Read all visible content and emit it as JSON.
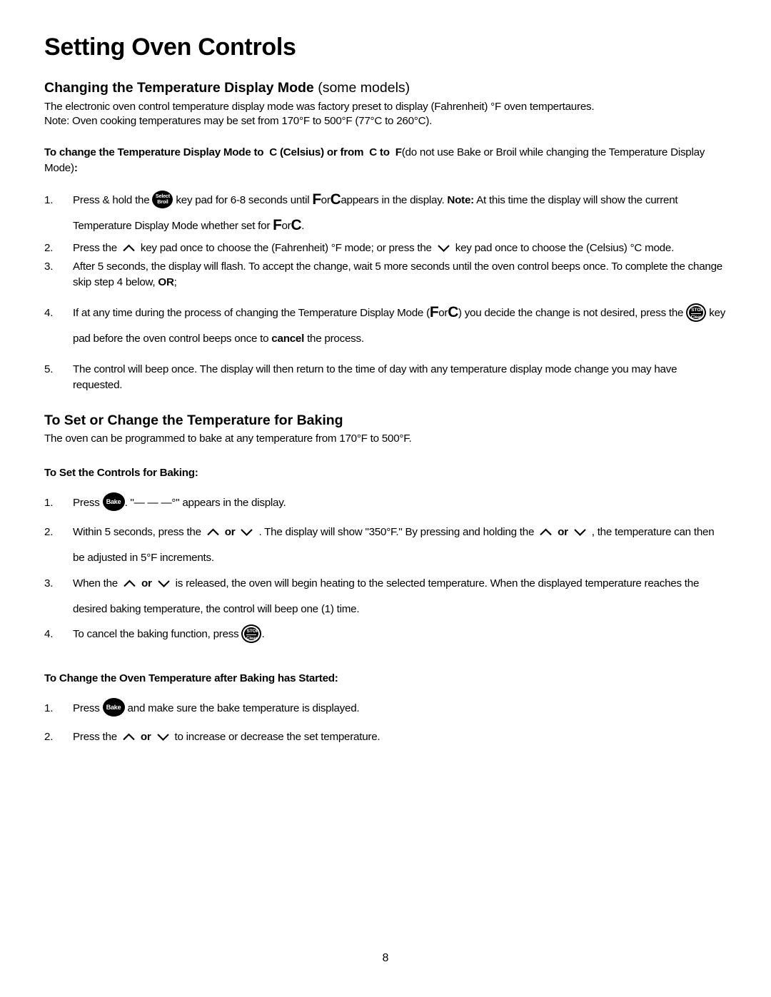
{
  "page": {
    "title": "Setting Oven Controls",
    "number": "8"
  },
  "section_display_mode": {
    "heading_bold": "Changing the Temperature Display Mode",
    "heading_light": "(some models)",
    "paragraph_line1": "The electronic oven control temperature display mode was factory preset to display (Fahrenheit) °F oven tempertaures.",
    "paragraph_line2": "Note: Oven cooking temperatures may be set from 170°F to 500°F (77°C to 260°C).",
    "lead_bold_a": "To change the Temperature Display Mode to",
    "lead_c1": "C",
    "lead_bold_b": "(Celsius) or from",
    "lead_c2": "C",
    "lead_bold_c": "to",
    "lead_f1": "F",
    "lead_light": "(do not use Bake or Broil while changing the Temperature Display Mode)",
    "lead_colon": ":",
    "steps": [
      {
        "num": "1.",
        "t1": "Press & hold the",
        "icon": "select-broil-keypad",
        "t2": "key pad for 6-8 seconds until",
        "glyph_f": "F",
        "t3": "or",
        "glyph_c": "C",
        "t4": "appears in the display.",
        "note_label": "Note:",
        "t5": "At this time the display will show the current Temperature Display Mode whether set for",
        "glyph_f2": "F",
        "t6": "or",
        "glyph_c2": "C",
        "t7": "."
      },
      {
        "num": "2.",
        "t1": "Press the",
        "icon_up": "chevron-up-icon",
        "t2": "key pad once to choose the (Fahrenheit) °F mode; or press  the",
        "icon_down": "chevron-down-icon",
        "t3": "key pad once to choose the (Celsius) °C mode."
      },
      {
        "num": "3.",
        "t1": "After 5 seconds, the display will flash. To accept the change, wait 5 more seconds until the oven control beeps once. To complete the change skip step 4 below,",
        "bold_or": "OR",
        "t2": ";"
      },
      {
        "num": "4.",
        "t1": "If at any time during the process of changing the Temperature Display Mode (",
        "glyph_f": "F",
        "t2": "or",
        "glyph_c": "C",
        "t3": ") you decide the change is not desired, press the",
        "icon": "stop-clear-keypad",
        "t4": "key pad before the oven control beeps once to",
        "bold_cancel": "cancel",
        "t5": "the process."
      },
      {
        "num": "5.",
        "t1": "The control will beep once. The display will then return to the time of day with any temperature display mode change you may have requested."
      }
    ]
  },
  "section_baking": {
    "heading": "To Set or Change the Temperature for Baking",
    "paragraph": "The oven can be programmed to bake at any temperature from 170°F to 500°F.",
    "sub_heading_1": "To Set the Controls for Baking:",
    "steps_1": [
      {
        "num": "1.",
        "t1": "Press",
        "icon": "bake-keypad",
        "t2": ". \"— — —°\" appears in the display."
      },
      {
        "num": "2.",
        "t1": "Within 5 seconds, press the",
        "icon_up": "chevron-up-icon",
        "bold_or": "or",
        "icon_down": "chevron-down-icon",
        "t2": ". The display will show \"350°F.\" By pressing and holding the",
        "icon_up2": "chevron-up-icon",
        "bold_or2": "or",
        "icon_down2": "chevron-down-icon",
        "t3": ", the temperature can then be adjusted in 5°F increments."
      },
      {
        "num": "3.",
        "t1": "When the",
        "icon_up": "chevron-up-icon",
        "bold_or": "or",
        "icon_down": "chevron-down-icon",
        "t2": "is released, the oven will begin heating to the selected temperature. When the displayed temperature reaches the desired baking temperature, the control will beep one (1) time."
      },
      {
        "num": "4.",
        "t1": "To cancel the baking function, press",
        "icon": "stop-clear-keypad",
        "t2": "."
      }
    ],
    "sub_heading_2": "To Change the Oven Temperature after Baking has Started:",
    "steps_2": [
      {
        "num": "1.",
        "t1": "Press",
        "icon": "bake-keypad",
        "t2": "and make sure the bake temperature is displayed."
      },
      {
        "num": "2.",
        "t1": "Press the",
        "icon_up": "chevron-up-icon",
        "bold_or": "or",
        "icon_down": "chevron-down-icon",
        "t2": "to increase or decrease the set temperature."
      }
    ]
  },
  "icons": {
    "select_broil_line1": "Select",
    "select_broil_line2": "Broil",
    "bake_label": "Bake",
    "stop_label": "STOP",
    "clear_label": "Clear"
  },
  "colors": {
    "text": "#000000",
    "background": "#ffffff",
    "keypad_fill": "#000000",
    "keypad_text": "#ffffff"
  }
}
